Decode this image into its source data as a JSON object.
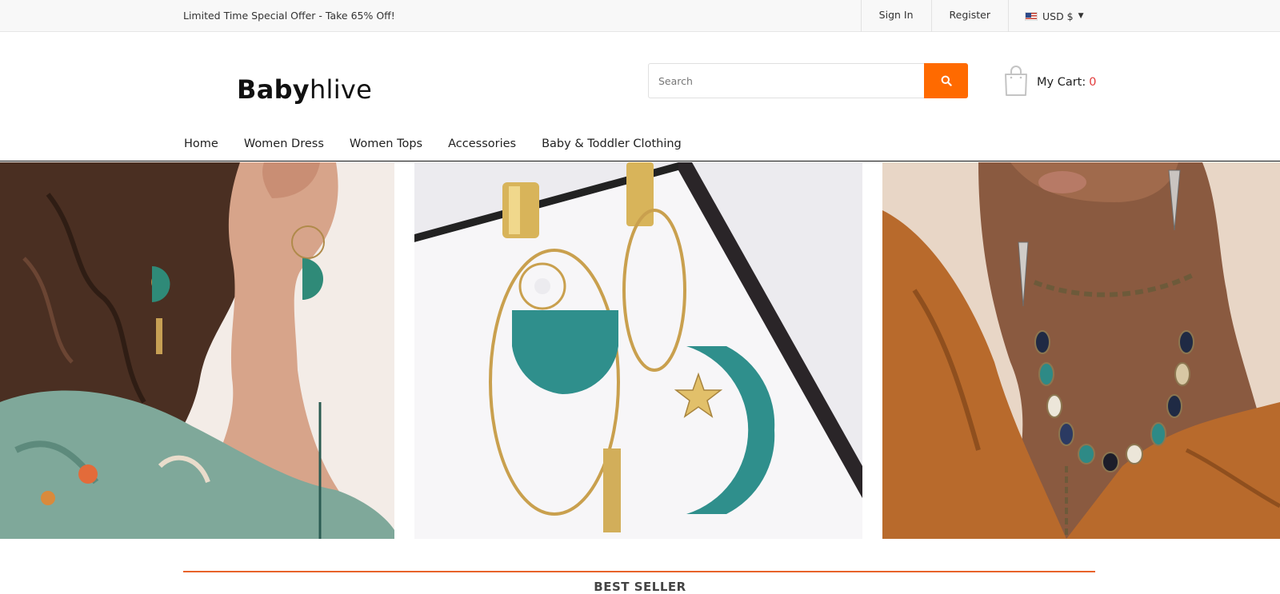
{
  "topbar": {
    "promo": "Limited Time Special Offer - Take 65% Off!",
    "sign_in": "Sign In",
    "register": "Register",
    "currency": "USD $"
  },
  "header": {
    "logo_bold": "Baby",
    "logo_light": "hlive",
    "search_placeholder": "Search",
    "cart_label": "My Cart:",
    "cart_count": "0"
  },
  "nav": {
    "items": [
      "Home",
      "Women Dress",
      "Women Tops",
      "Accessories",
      "Baby & Toddler Clothing"
    ]
  },
  "banners": [
    {
      "subject": "woman-wearing-teal-earrings"
    },
    {
      "subject": "teal-gold-drop-earrings"
    },
    {
      "subject": "woman-wearing-statement-necklace"
    }
  ],
  "section": {
    "title": "BEST SELLER"
  },
  "colors": {
    "accent": "#ff6a00",
    "cart_count": "#e23b3b",
    "section_line": "#e8622a"
  }
}
